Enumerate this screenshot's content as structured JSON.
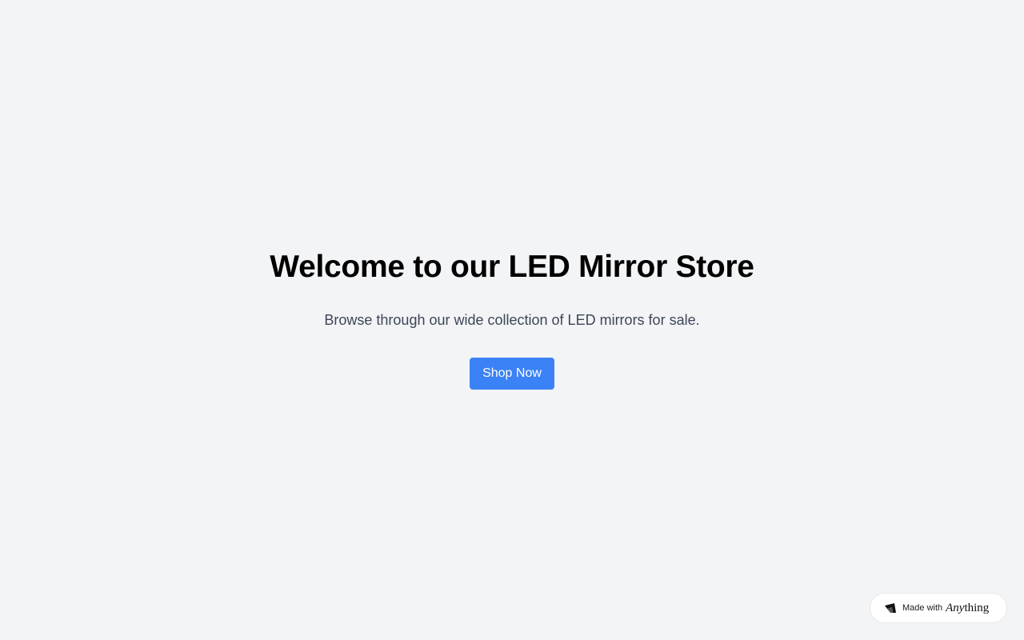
{
  "hero": {
    "title": "Welcome to our LED Mirror Store",
    "subtitle": "Browse through our wide collection of LED mirrors for sale.",
    "cta_label": "Shop Now"
  },
  "badge": {
    "prefix": "Made with",
    "brand_italic": "Any",
    "brand_rest": "thing",
    "icon": "anything-logo-icon"
  },
  "colors": {
    "background": "#f2f4f6",
    "accent": "#3b82f6",
    "title": "#000000",
    "subtitle": "#3d4656"
  }
}
